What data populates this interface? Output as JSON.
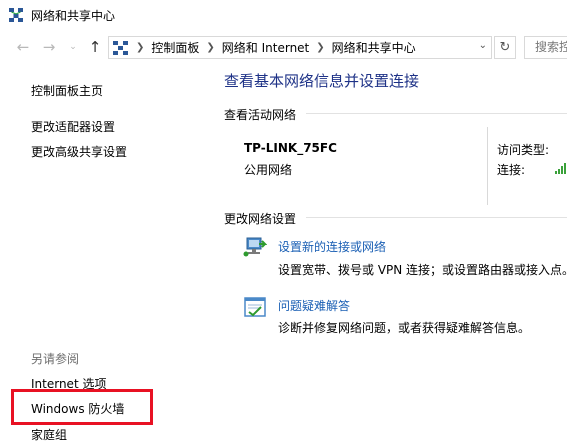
{
  "window": {
    "title": "网络和共享中心"
  },
  "navbar": {
    "back_icon": "arrow-left",
    "forward_icon": "arrow-right",
    "history_icon": "chevron-down",
    "up_icon": "arrow-up",
    "breadcrumbs": [
      "控制面板",
      "网络和 Internet",
      "网络和共享中心"
    ],
    "search_placeholder": "搜索控制面板"
  },
  "sidebar": {
    "home": "控制面板主页",
    "items": [
      "更改适配器设置",
      "更改高级共享设置"
    ],
    "see_also_label": "另请参阅",
    "see_also": [
      "Internet 选项",
      "Windows 防火墙",
      "家庭组"
    ],
    "highlight_color": "#e81123"
  },
  "main": {
    "title": "查看基本网络信息并设置连接",
    "active_label": "查看活动网络",
    "network": {
      "name": "TP-LINK_75FC",
      "type": "公用网络",
      "access_label": "访问类型:",
      "conn_label": "连接:"
    },
    "change_label": "更改网络设置",
    "tasks": [
      {
        "link": "设置新的连接或网络",
        "desc": "设置宽带、拨号或 VPN 连接；或设置路由器或接入点。",
        "icon": "new-connection-icon"
      },
      {
        "link": "问题疑难解答",
        "desc": "诊断并修复网络问题，或者获得疑难解答信息。",
        "icon": "troubleshoot-icon"
      }
    ]
  }
}
